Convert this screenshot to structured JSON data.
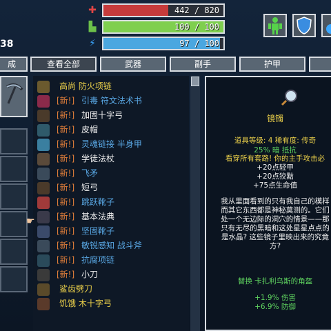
{
  "player": {
    "level": "38"
  },
  "stats": {
    "hp": {
      "value": "442 / 820",
      "fraction": 0.54,
      "icon": "health-cross-icon",
      "color": "#c63b3b"
    },
    "stamina": {
      "value": "100 / 100",
      "fraction": 1.0,
      "icon": "stamina-boot-icon",
      "color": "#7fcf4f"
    },
    "mana": {
      "value": "97 / 100",
      "fraction": 0.97,
      "icon": "mana-bolt-icon",
      "color": "#4aa7e0"
    }
  },
  "top_icons": [
    "character-icon",
    "shield-icon",
    "potion-icon"
  ],
  "tabs": [
    {
      "label": "成"
    },
    {
      "label": "查看全部"
    },
    {
      "label": "武器"
    },
    {
      "label": "副手"
    },
    {
      "label": "护甲"
    }
  ],
  "new_tag": "[新!]",
  "items": [
    {
      "name": "高尚 防火项链",
      "new": false,
      "icon": "amulet-icon"
    },
    {
      "name": "引毒 符文法术书",
      "new": true,
      "icon": "spellbook-icon"
    },
    {
      "name": "加固十字弓",
      "new": true,
      "icon": "crossbow-icon"
    },
    {
      "name": "皮帽",
      "new": true,
      "icon": "hat-icon"
    },
    {
      "name": "灵魂链接 半身甲",
      "new": true,
      "icon": "armor-icon"
    },
    {
      "name": "学徒法杖",
      "new": true,
      "icon": "staff-icon"
    },
    {
      "name": "飞矛",
      "new": true,
      "icon": "spear-icon"
    },
    {
      "name": "短弓",
      "new": true,
      "icon": "bow-icon"
    },
    {
      "name": "跳跃靴子",
      "new": true,
      "icon": "boots-icon"
    },
    {
      "name": "基本法典",
      "new": true,
      "icon": "tome-icon"
    },
    {
      "name": "坚固靴子",
      "new": true,
      "icon": "boots-icon"
    },
    {
      "name": "敏锐感知 战斗斧",
      "new": true,
      "icon": "axe-icon"
    },
    {
      "name": "抗腐项链",
      "new": true,
      "icon": "amulet-icon"
    },
    {
      "name": "小刀",
      "new": true,
      "icon": "dagger-icon"
    },
    {
      "name": "鲨齿劈刀",
      "new": false,
      "icon": "cleaver-icon"
    },
    {
      "name": "饥饿 木十字弓",
      "new": false,
      "icon": "crossbow-icon"
    }
  ],
  "detail": {
    "title": "镜镯",
    "level_line": "道具等级: 4 稀有度: 传奇",
    "resist": "25% 暗 抵抗",
    "set_line": "看穿所有套路! 你的主手攻击必",
    "bonuses": [
      "+20点轻甲",
      "+20点狡黠",
      "+75点生命值"
    ],
    "lore": [
      "我从里面看到的只有我自己的模样",
      "而其它东西都是神秘莫测的。它们",
      "处一个无边际的洞穴的情景——那",
      "只有无尽的黑暗和这处星星点点的",
      "是水晶? 这些镜子里映出来的究竟",
      "方?"
    ],
    "replace": "替换 卡扎利乌斯的角盔",
    "diffs": [
      "+1.9% 伤害",
      "+6.9% 防御"
    ]
  }
}
